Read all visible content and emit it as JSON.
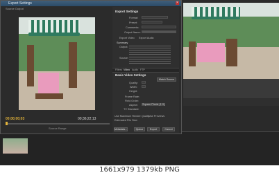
{
  "dialog": {
    "title": "Export Settings",
    "source_tab": "Source Output",
    "timecode_in": "00;00;00;03",
    "timecode_out": "00;36;22;13",
    "source_range_label": "Source Range",
    "export_settings": {
      "header": "Export Settings",
      "format_label": "Format:",
      "preset_label": "Preset:",
      "comments_label": "Comments:",
      "output_name_label": "Output Name:",
      "export_video_label": "Export Video",
      "export_audio_label": "Export Audio",
      "summary_header": "Summary",
      "output_label": "Output:",
      "source_label": "Source:"
    },
    "tabs": [
      "Filters",
      "Video",
      "Audio",
      "FTP"
    ],
    "basic_video": {
      "header": "Basic Video Settings",
      "match_source_button": "Match Source",
      "quality_label": "Quality:",
      "width_label": "Width:",
      "height_label": "Height:",
      "frame_rate_label": "Frame Rate:",
      "field_order_label": "Field Order:",
      "aspect_label": "Aspect:",
      "aspect_value": "Square Pixels (1.0)",
      "tv_standard_label": "TV Standard:",
      "use_max_render_label": "Use Maximum Render Quality",
      "use_previews_label": "Use Previews",
      "estimated_size_label": "Estimated File Size:"
    },
    "buttons": {
      "metadata": "Metadata...",
      "queue": "Queue",
      "export": "Export",
      "cancel": "Cancel"
    }
  },
  "caption": "1661x979  1379kb  PNG"
}
